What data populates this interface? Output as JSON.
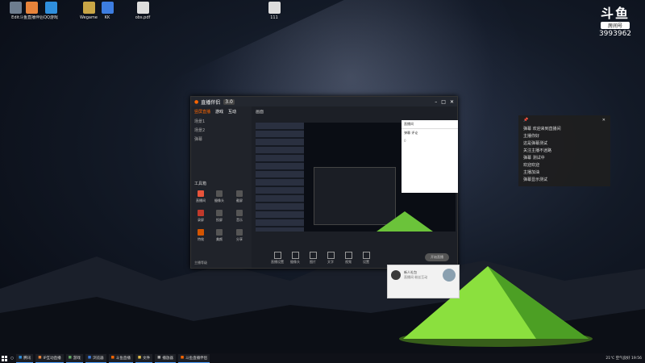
{
  "logo": {
    "brand": "斗鱼",
    "room_label": "房间号",
    "room_number": "3993962"
  },
  "desktop_icons": [
    {
      "label": "Edit",
      "color": "#6d7d8f"
    },
    {
      "label": "斗鱼直播伴侣",
      "color": "#e8843b"
    },
    {
      "label": "QQ游戏",
      "color": "#2f8fdd"
    },
    {
      "label": "Wegame",
      "color": "#c9a646"
    },
    {
      "label": "KK",
      "color": "#3d7de0"
    },
    {
      "label": "obs.pdf",
      "color": "#ddd"
    },
    {
      "label": "111",
      "color": "#ddd"
    }
  ],
  "app": {
    "title": "直播伴侣",
    "version": "3.0",
    "tabs": [
      "竖屏直播",
      "游戏",
      "互动"
    ],
    "scene_title": "画面",
    "sidebar_items": [
      "场景1",
      "场景2",
      "弹幕"
    ],
    "tools_label": "工具箱",
    "tools": [
      "直播间",
      "摄像头",
      "截屏",
      "录屏",
      "投屏",
      "音乐",
      "特效",
      "美颜",
      "分享"
    ],
    "bottom_tools": [
      "直播设置",
      "摄像头",
      "图片",
      "文字",
      "视频",
      "设置"
    ],
    "sidebar_bottom": "主播等级",
    "start_button": "开始直播"
  },
  "chat": {
    "title": "直播间",
    "item": "弹幕 评论",
    "count": "0"
  },
  "popup": {
    "title": "新人礼包",
    "desc": "直播间 粉丝互动"
  },
  "danmu": {
    "lines": [
      "弹幕 欢迎来到直播间",
      "主播你好",
      "这是弹幕测试",
      "关注主播不迷路",
      "弹幕 测试中",
      "欢迎欢迎",
      "主播加油",
      "弹幕显示测试"
    ]
  },
  "taskbar": {
    "tasks": [
      "腾讯",
      "IP互动直播",
      "游戏",
      "浏览器",
      "斗鱼直播",
      "文件",
      "播放器",
      "斗鱼直播伴侣"
    ],
    "tray": "21℃ 空气良好 19:56"
  }
}
